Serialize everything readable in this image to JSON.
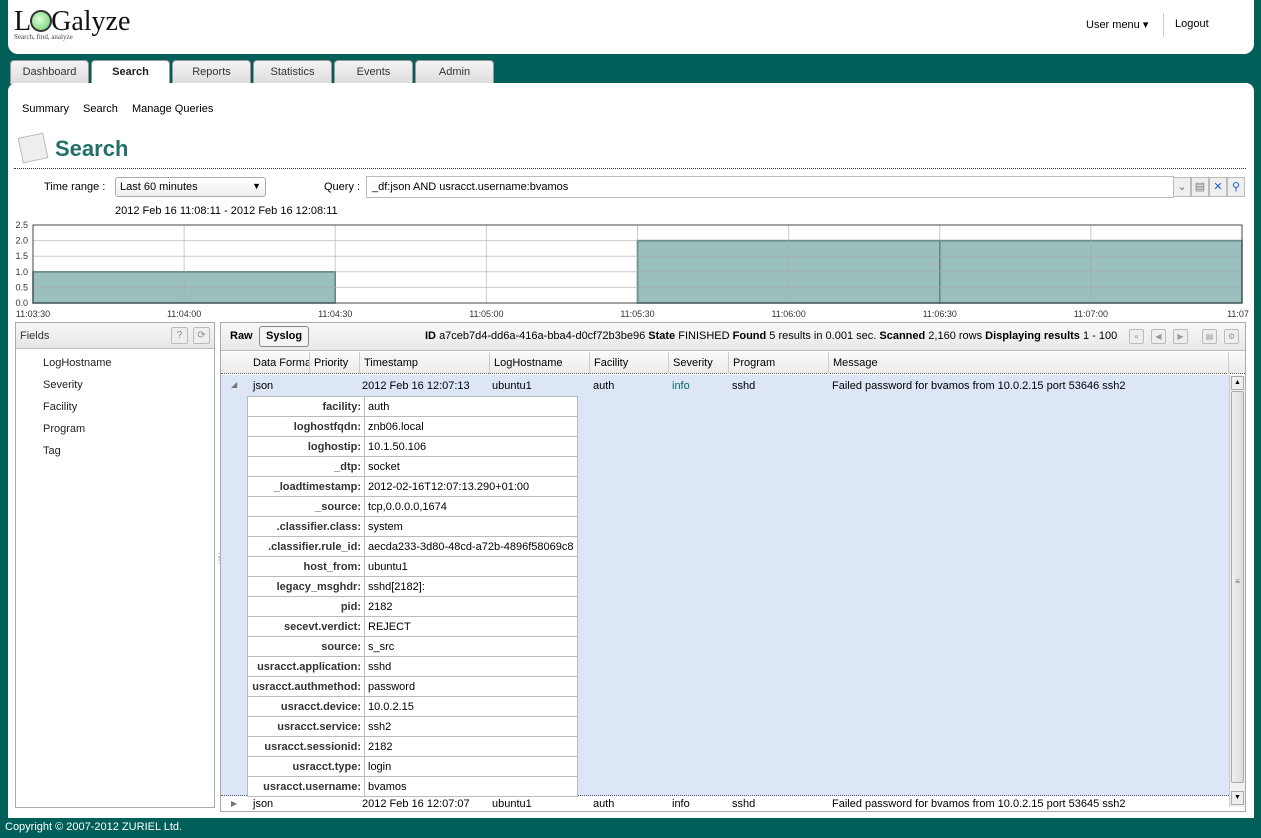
{
  "header": {
    "logo_text": "LOGalyze",
    "tagline": "Search, find, analyze",
    "user_menu": "User menu",
    "logout": "Logout"
  },
  "tabs": [
    {
      "label": "Dashboard"
    },
    {
      "label": "Search",
      "active": true
    },
    {
      "label": "Reports"
    },
    {
      "label": "Statistics"
    },
    {
      "label": "Events"
    },
    {
      "label": "Admin"
    }
  ],
  "subnav": [
    "Summary",
    "Search",
    "Manage Queries"
  ],
  "page_title": "Search",
  "search": {
    "time_range_label": "Time range :",
    "time_range_value": "Last 60 minutes",
    "query_label": "Query :",
    "query_value": "_df:json AND usracct.username:bvamos",
    "range_text": "2012 Feb 16 11:08:11 - 2012 Feb 16 12:08:11"
  },
  "chart_data": {
    "type": "bar",
    "x_ticks": [
      "11:03:30",
      "11:04:00",
      "11:04:30",
      "11:05:00",
      "11:05:30",
      "11:06:00",
      "11:06:30",
      "11:07:00",
      "11:07"
    ],
    "y_ticks": [
      "0.0",
      "0.5",
      "1.0",
      "1.5",
      "2.0",
      "2.5"
    ],
    "ylim": [
      0,
      2.5
    ],
    "bars": [
      {
        "start": "11:03:30",
        "end": "11:04:30",
        "value": 1
      },
      {
        "start": "11:05:30",
        "end": "11:06:30",
        "value": 2
      },
      {
        "start": "11:06:30",
        "end": "11:07:30",
        "value": 2
      }
    ],
    "color": "#9bbfbd",
    "edge": "#2f6e68",
    "grid": true
  },
  "fields": {
    "title": "Fields",
    "items": [
      "LogHostname",
      "Severity",
      "Facility",
      "Program",
      "Tag"
    ]
  },
  "grid": {
    "raw_label": "Raw",
    "syslog_label": "Syslog",
    "status": {
      "id_label": "ID",
      "id": "a7ceb7d4-dd6a-416a-bba4-d0cf72b3be96",
      "state_label": "State",
      "state": "FINISHED",
      "found_label": "Found",
      "found": "5 results in 0.001 sec.",
      "scanned_label": "Scanned",
      "scanned": "2,160 rows",
      "displaying_label": "Displaying results",
      "displaying": "1 - 100"
    },
    "columns": [
      "Data Format",
      "Priority",
      "Timestamp",
      "LogHostname",
      "Facility",
      "Severity",
      "Program",
      "Message"
    ],
    "rows": [
      {
        "format": "json",
        "priority": "",
        "timestamp": "2012 Feb 16 12:07:13",
        "host": "ubuntu1",
        "facility": "auth",
        "severity": "info",
        "program": "sshd",
        "message": "Failed password for bvamos from 10.0.2.15 port 53646 ssh2"
      },
      {
        "format": "json",
        "priority": "",
        "timestamp": "2012 Feb 16 12:07:07",
        "host": "ubuntu1",
        "facility": "auth",
        "severity": "info",
        "program": "sshd",
        "message": "Failed password for bvamos from 10.0.2.15 port 53645 ssh2"
      }
    ],
    "details": [
      [
        "facility:",
        "auth"
      ],
      [
        "loghostfqdn:",
        "znb06.local"
      ],
      [
        "loghostip:",
        "10.1.50.106"
      ],
      [
        "_dtp:",
        "socket"
      ],
      [
        "_loadtimestamp:",
        "2012-02-16T12:07:13.290+01:00"
      ],
      [
        "_source:",
        "tcp,0.0.0.0,1674"
      ],
      [
        ".classifier.class:",
        "system"
      ],
      [
        ".classifier.rule_id:",
        "aecda233-3d80-48cd-a72b-4896f58069c8"
      ],
      [
        "host_from:",
        "ubuntu1"
      ],
      [
        "legacy_msghdr:",
        "sshd[2182]:"
      ],
      [
        "pid:",
        "2182"
      ],
      [
        "secevt.verdict:",
        "REJECT"
      ],
      [
        "source:",
        "s_src"
      ],
      [
        "usracct.application:",
        "sshd"
      ],
      [
        "usracct.authmethod:",
        "password"
      ],
      [
        "usracct.device:",
        "10.0.2.15"
      ],
      [
        "usracct.service:",
        "ssh2"
      ],
      [
        "usracct.sessionid:",
        "2182"
      ],
      [
        "usracct.type:",
        "login"
      ],
      [
        "usracct.username:",
        "bvamos"
      ]
    ]
  },
  "footer": "Copyright © 2007-2012 ZURIEL Ltd."
}
